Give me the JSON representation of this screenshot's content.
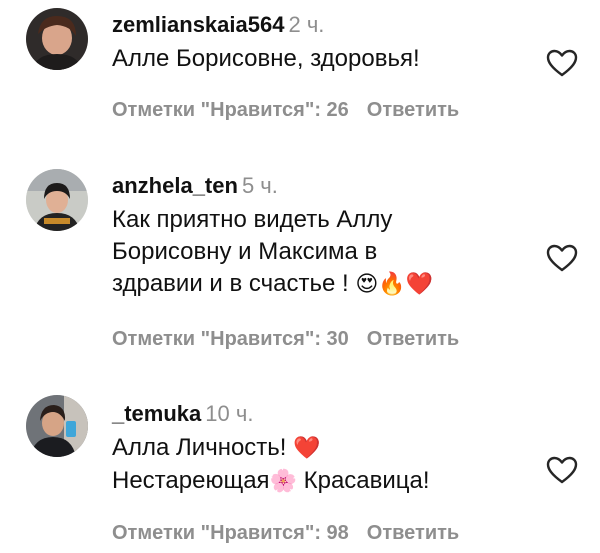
{
  "comments": [
    {
      "username": "zemlianskaia564",
      "time": "2 ч.",
      "text": "Алле Борисовне, здоровья!",
      "likes_label": "Отметки \"Нравится\": 26",
      "reply_label": "Ответить",
      "avatar": "woman-avatar"
    },
    {
      "username": "anzhela_ten",
      "time": "5 ч.",
      "text_lines": [
        "Как приятно видеть Аллу",
        "Борисовну и Максима в",
        "здравии и в счастье ! "
      ],
      "emojis": [
        "😍",
        "🔥",
        "❤️"
      ],
      "likes_label": "Отметки \"Нравится\": 30",
      "reply_label": "Ответить",
      "avatar": "woman-avatar"
    },
    {
      "username": "_temuka",
      "time": "10 ч.",
      "text_lines": [
        "Алла Личность! ",
        "Нестареющая",
        " Красавица!"
      ],
      "emojis": [
        "❤️",
        "🌸"
      ],
      "likes_label": "Отметки \"Нравится\": 98",
      "reply_label": "Ответить",
      "avatar": "man-avatar"
    }
  ],
  "colors": {
    "text": "#111111",
    "muted": "#8e8e8e",
    "heart_outline": "#262626",
    "red_heart": "#e8323c"
  },
  "icons": {
    "like": "heart-outline-icon"
  }
}
